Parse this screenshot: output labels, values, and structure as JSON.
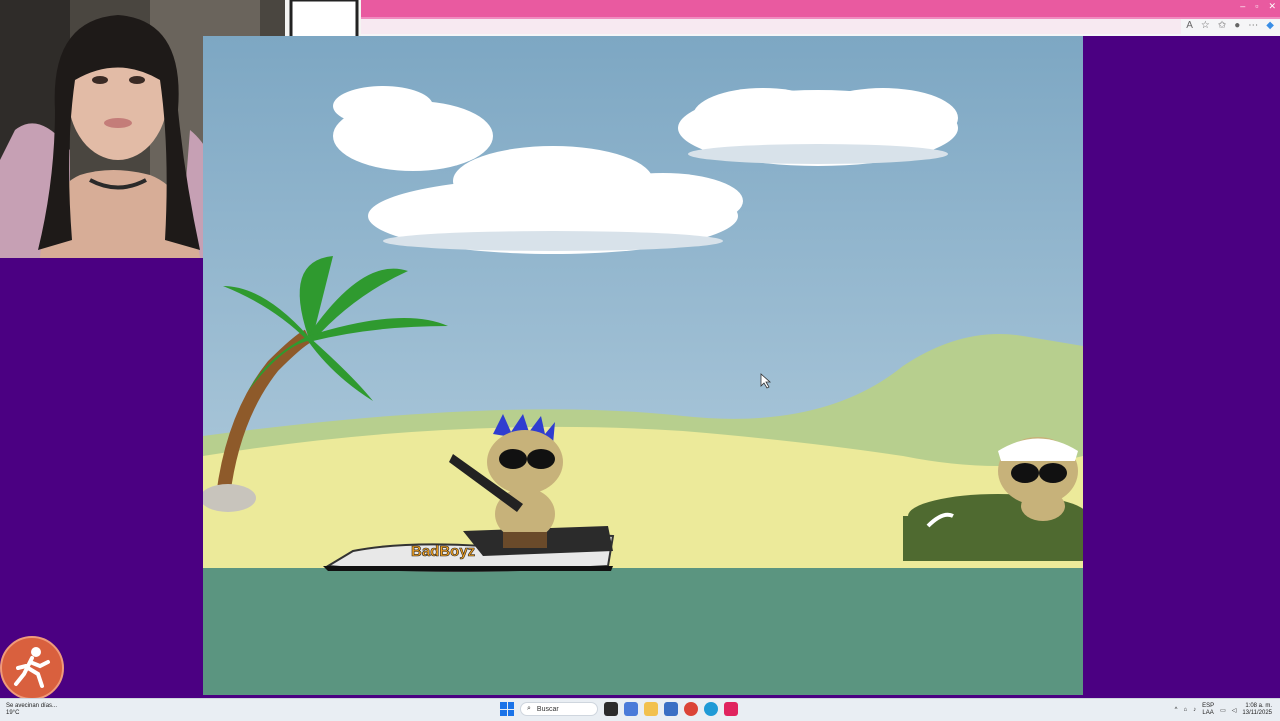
{
  "game": {
    "jetski_brand": "BadBoyz"
  },
  "taskbar": {
    "weather_text": "Se avecinan días...",
    "temperature": "19°C",
    "search_placeholder": "Buscar",
    "language_line1": "ESP",
    "language_line2": "LAA",
    "time": "1:08 a. m.",
    "date": "13/11/2025"
  },
  "browser": {
    "window_controls": [
      "–",
      "▫",
      "✕"
    ]
  },
  "icons": {
    "start": "windows-start-icon",
    "exit": "running-person-icon"
  },
  "colors": {
    "page_background": "#4b0082",
    "browser_accent": "#e95aa0",
    "sky": "#8fb4cc",
    "water": "#5b9580"
  }
}
